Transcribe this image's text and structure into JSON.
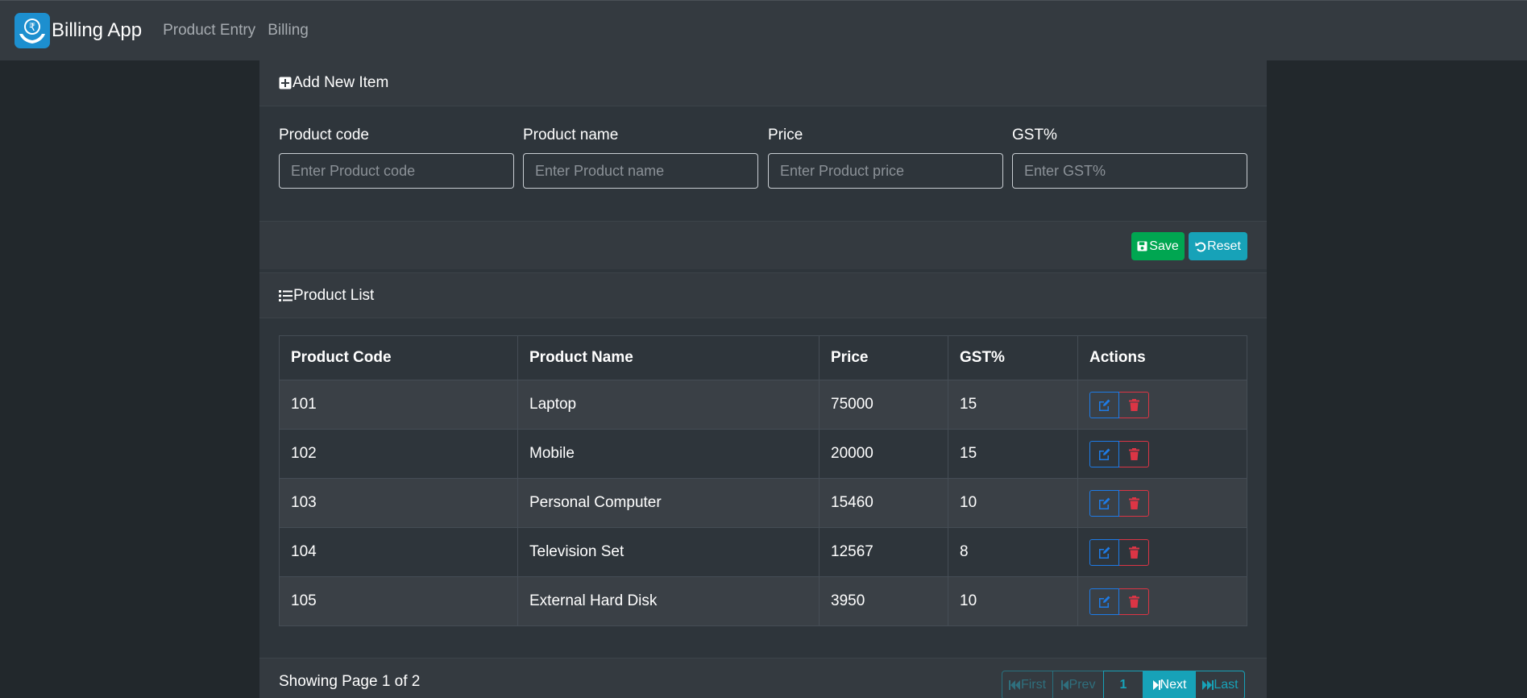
{
  "app": {
    "title": "Billing App"
  },
  "nav": {
    "links": [
      "Product Entry",
      "Billing"
    ]
  },
  "form": {
    "header": "Add New Item",
    "fields": [
      {
        "label": "Product code",
        "placeholder": "Enter Product code",
        "value": ""
      },
      {
        "label": "Product name",
        "placeholder": "Enter Product name",
        "value": ""
      },
      {
        "label": "Price",
        "placeholder": "Enter Product price",
        "value": ""
      },
      {
        "label": "GST%",
        "placeholder": "Enter GST%",
        "value": ""
      }
    ],
    "save_label": "Save",
    "reset_label": "Reset"
  },
  "list": {
    "header": "Product List",
    "columns": [
      "Product Code",
      "Product Name",
      "Price",
      "GST%",
      "Actions"
    ],
    "rows": [
      {
        "code": "101",
        "name": "Laptop",
        "price": "75000",
        "gst": "15"
      },
      {
        "code": "102",
        "name": "Mobile",
        "price": "20000",
        "gst": "15"
      },
      {
        "code": "103",
        "name": "Personal Computer",
        "price": "15460",
        "gst": "10"
      },
      {
        "code": "104",
        "name": "Television Set",
        "price": "12567",
        "gst": "8"
      },
      {
        "code": "105",
        "name": "External Hard Disk",
        "price": "3950",
        "gst": "10"
      }
    ],
    "page_status": "Showing Page 1 of 2"
  },
  "pagination": {
    "first": "First",
    "prev": "Prev",
    "current": "1",
    "next": "Next",
    "last": "Last"
  },
  "colors": {
    "navbar": "#343a40",
    "save": "#00a651",
    "info": "#17a2b8",
    "edit": "#1e7be6",
    "delete": "#dc3545"
  }
}
